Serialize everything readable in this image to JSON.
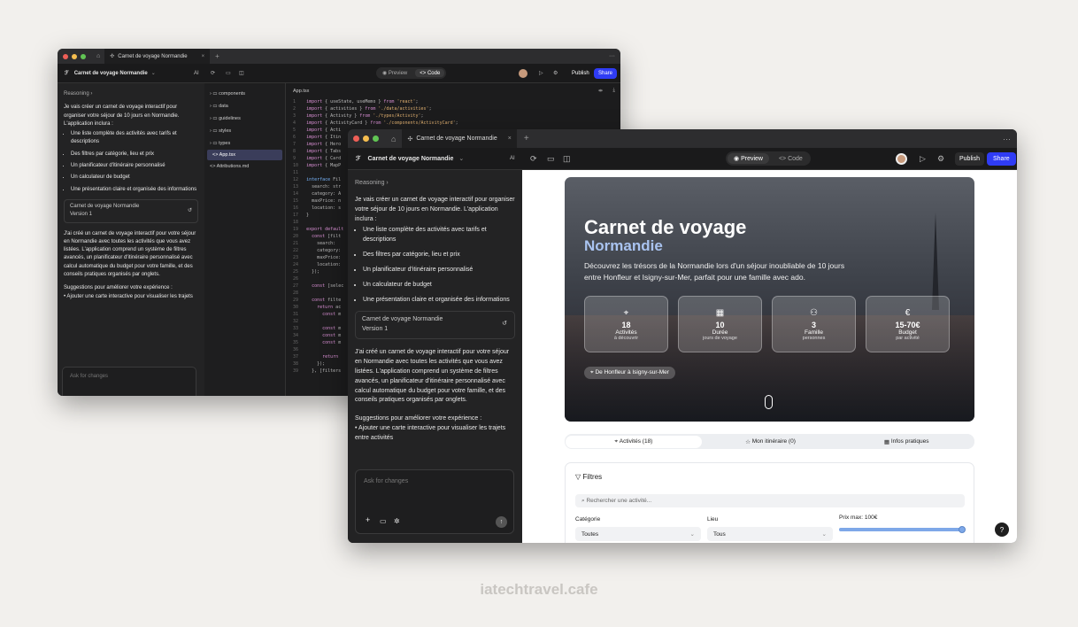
{
  "back": {
    "tab_title": "Carnet de voyage Normandie",
    "project_title": "Carnet de voyage Normandie",
    "ai_label": "AI",
    "reasoning": "Reasoning",
    "intro": "Je vais créer un carnet de voyage interactif pour organiser votre séjour de 10 jours en Normandie. L'application inclura :",
    "bullets": [
      "Une liste complète des activités avec tarifs et descriptions",
      "Des filtres par catégorie, lieu et prix",
      "Un planificateur d'itinéraire personnalisé",
      "Un calculateur de budget",
      "Une présentation claire et organisée des informations"
    ],
    "version_title": "Carnet de voyage Normandie",
    "version_label": "Version 1",
    "summary": "J'ai créé un carnet de voyage interactif pour votre séjour en Normandie avec toutes les activités que vous avez listées. L'application comprend un système de filtres avancés, un planificateur d'itinéraire personnalisé avec calcul automatique du budget pour votre famille, et des conseils pratiques organisés par onglets.",
    "suggestions": "Suggestions pour améliorer votre expérience :",
    "suggestion_1": "• Ajouter une carte interactive pour visualiser les trajets entre activités",
    "ask_placeholder": "Ask for changes",
    "preview_label": "Preview",
    "code_label": "Code",
    "publish_label": "Publish",
    "share_label": "Share",
    "files": [
      "components",
      "data",
      "guidelines",
      "styles",
      "types",
      "App.tsx",
      "Attributions.md"
    ],
    "open_file": "App.tsx"
  },
  "front": {
    "tab_title": "Carnet de voyage Normandie",
    "project_title": "Carnet de voyage Normandie",
    "ai_label": "AI",
    "reasoning": "Reasoning",
    "intro": "Je vais créer un carnet de voyage interactif pour organiser votre séjour de 10 jours en Normandie. L'application inclura :",
    "bullets": [
      "Une liste complète des activités avec tarifs et descriptions",
      "Des filtres par catégorie, lieu et prix",
      "Un planificateur d'itinéraire personnalisé",
      "Un calculateur de budget",
      "Une présentation claire et organisée des informations"
    ],
    "version_title": "Carnet de voyage Normandie",
    "version_label": "Version 1",
    "summary": "J'ai créé un carnet de voyage interactif pour votre séjour en Normandie avec toutes les activités que vous avez listées. L'application comprend un système de filtres avancés, un planificateur d'itinéraire personnalisé avec calcul automatique du budget pour votre famille, et des conseils pratiques organisés par onglets.",
    "suggestions": "Suggestions pour améliorer votre expérience :",
    "suggestion_1": "• Ajouter une carte interactive pour visualiser les trajets entre activités",
    "ask_placeholder": "Ask for changes",
    "preview_label": "Preview",
    "code_label": "Code",
    "publish_label": "Publish",
    "share_label": "Share"
  },
  "app": {
    "hero_title": "Carnet de voyage",
    "hero_subtitle": "Normandie",
    "hero_desc": "Découvrez les trésors de la Normandie lors d'un séjour inoubliable de 10 jours entre Honfleur et Isigny-sur-Mer, parfait pour une famille avec ado.",
    "stats": [
      {
        "icon": "map-pin-icon",
        "value": "18",
        "label": "Activités",
        "sub": "à découvrir"
      },
      {
        "icon": "calendar-icon",
        "value": "10",
        "label": "Durée",
        "sub": "jours de voyage"
      },
      {
        "icon": "users-icon",
        "value": "3",
        "label": "Famille",
        "sub": "personnes"
      },
      {
        "icon": "euro-icon",
        "value": "15-70€",
        "label": "Budget",
        "sub": "par activité"
      }
    ],
    "route_badge": "De Honfleur à Isigny-sur-Mer",
    "tabs": [
      "Activités (18)",
      "Mon itinéraire (0)",
      "Infos pratiques"
    ],
    "filters_title": "Filtres",
    "search_placeholder": "Rechercher une activité...",
    "category_label": "Catégorie",
    "category_value": "Toutes",
    "lieu_label": "Lieu",
    "lieu_value": "Tous",
    "price_label": "Prix max: 100€",
    "price_fraction": 1.0,
    "help": "?"
  },
  "watermark": "iatechtravel.cafe",
  "colors": {
    "accent": "#2f3cf5",
    "hero_sub": "#a9c3f0",
    "slider": "#7ea8e8"
  }
}
